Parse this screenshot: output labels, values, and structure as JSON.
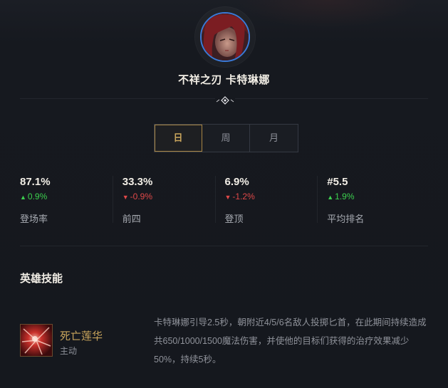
{
  "hero": {
    "name": "不祥之刃 卡特琳娜"
  },
  "colors": {
    "accent": "#c9a55c",
    "avatar_ring": "#3a7ad8",
    "up": "#3ccf4e",
    "down": "#e04848"
  },
  "tabs": [
    {
      "label": "日",
      "active": true
    },
    {
      "label": "周",
      "active": false
    },
    {
      "label": "月",
      "active": false
    }
  ],
  "stats": [
    {
      "value": "87.1%",
      "direction": "up",
      "change": "0.9%",
      "label": "登场率"
    },
    {
      "value": "33.3%",
      "direction": "down",
      "change": "-0.9%",
      "label": "前四"
    },
    {
      "value": "6.9%",
      "direction": "down",
      "change": "-1.2%",
      "label": "登顶"
    },
    {
      "value": "#5.5",
      "direction": "up",
      "change": "1.9%",
      "label": "平均排名"
    }
  ],
  "section": {
    "skills_title": "英雄技能"
  },
  "skill": {
    "name": "死亡莲华",
    "type": "主动",
    "description": "卡特琳娜引导2.5秒，朝附近4/5/6名敌人投掷匕首，在此期间持续造成共650/1000/1500魔法伤害，并使他的目标们获得的治疗效果减少50%，持续5秒。",
    "icon": "death-lotus-skill-icon"
  }
}
